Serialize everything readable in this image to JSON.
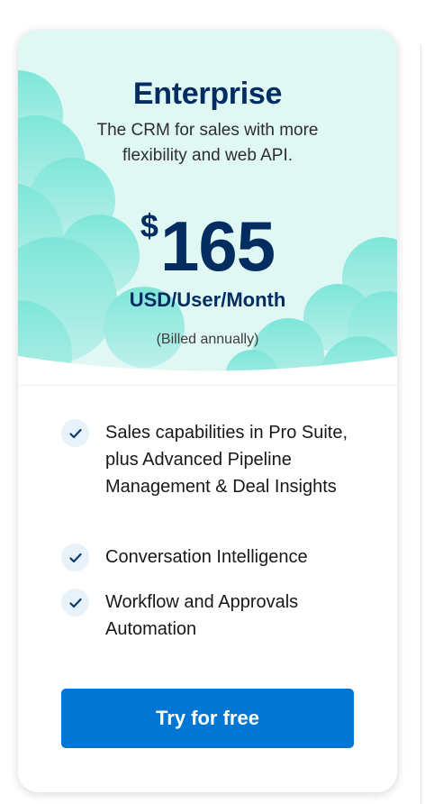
{
  "plan": {
    "name": "Enterprise",
    "description": "The CRM for sales with more flexibility and web API.",
    "price": {
      "currency_symbol": "$",
      "amount": "165",
      "unit": "USD/User/Month",
      "billing": "(Billed annually)"
    }
  },
  "features": [
    {
      "text": "Sales capabilities in Pro Suite, plus Advanced Pipeline Management & Deal Insights",
      "icon": "check-icon"
    },
    {
      "text": "Conversation Intelligence",
      "icon": "check-icon"
    },
    {
      "text": "Workflow and Approvals Automation",
      "icon": "check-icon"
    }
  ],
  "cta": {
    "label": "Try for free"
  },
  "colors": {
    "hero_bg": "#dff8f3",
    "cloud": "#7ee6d9",
    "heading": "#032d60",
    "button": "#0176d3",
    "check_bg": "#e8f2fb",
    "check": "#0b3a6e"
  }
}
